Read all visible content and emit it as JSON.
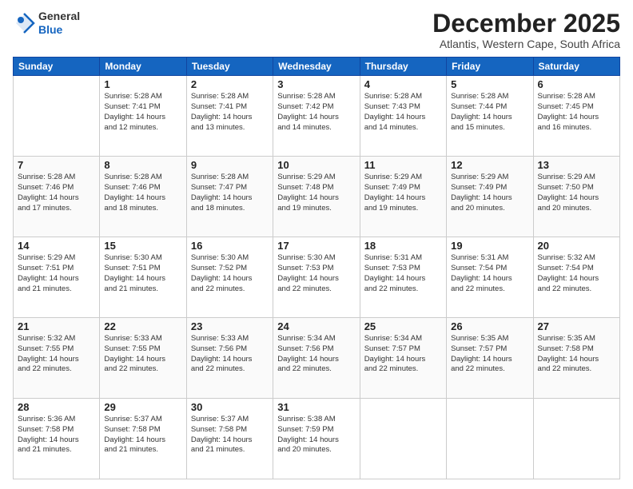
{
  "logo": {
    "general": "General",
    "blue": "Blue"
  },
  "title": "December 2025",
  "subtitle": "Atlantis, Western Cape, South Africa",
  "days": [
    "Sunday",
    "Monday",
    "Tuesday",
    "Wednesday",
    "Thursday",
    "Friday",
    "Saturday"
  ],
  "weeks": [
    [
      {
        "num": "",
        "info": ""
      },
      {
        "num": "1",
        "info": "Sunrise: 5:28 AM\nSunset: 7:41 PM\nDaylight: 14 hours\nand 12 minutes."
      },
      {
        "num": "2",
        "info": "Sunrise: 5:28 AM\nSunset: 7:41 PM\nDaylight: 14 hours\nand 13 minutes."
      },
      {
        "num": "3",
        "info": "Sunrise: 5:28 AM\nSunset: 7:42 PM\nDaylight: 14 hours\nand 14 minutes."
      },
      {
        "num": "4",
        "info": "Sunrise: 5:28 AM\nSunset: 7:43 PM\nDaylight: 14 hours\nand 14 minutes."
      },
      {
        "num": "5",
        "info": "Sunrise: 5:28 AM\nSunset: 7:44 PM\nDaylight: 14 hours\nand 15 minutes."
      },
      {
        "num": "6",
        "info": "Sunrise: 5:28 AM\nSunset: 7:45 PM\nDaylight: 14 hours\nand 16 minutes."
      }
    ],
    [
      {
        "num": "7",
        "info": "Sunrise: 5:28 AM\nSunset: 7:46 PM\nDaylight: 14 hours\nand 17 minutes."
      },
      {
        "num": "8",
        "info": "Sunrise: 5:28 AM\nSunset: 7:46 PM\nDaylight: 14 hours\nand 18 minutes."
      },
      {
        "num": "9",
        "info": "Sunrise: 5:28 AM\nSunset: 7:47 PM\nDaylight: 14 hours\nand 18 minutes."
      },
      {
        "num": "10",
        "info": "Sunrise: 5:29 AM\nSunset: 7:48 PM\nDaylight: 14 hours\nand 19 minutes."
      },
      {
        "num": "11",
        "info": "Sunrise: 5:29 AM\nSunset: 7:49 PM\nDaylight: 14 hours\nand 19 minutes."
      },
      {
        "num": "12",
        "info": "Sunrise: 5:29 AM\nSunset: 7:49 PM\nDaylight: 14 hours\nand 20 minutes."
      },
      {
        "num": "13",
        "info": "Sunrise: 5:29 AM\nSunset: 7:50 PM\nDaylight: 14 hours\nand 20 minutes."
      }
    ],
    [
      {
        "num": "14",
        "info": "Sunrise: 5:29 AM\nSunset: 7:51 PM\nDaylight: 14 hours\nand 21 minutes."
      },
      {
        "num": "15",
        "info": "Sunrise: 5:30 AM\nSunset: 7:51 PM\nDaylight: 14 hours\nand 21 minutes."
      },
      {
        "num": "16",
        "info": "Sunrise: 5:30 AM\nSunset: 7:52 PM\nDaylight: 14 hours\nand 22 minutes."
      },
      {
        "num": "17",
        "info": "Sunrise: 5:30 AM\nSunset: 7:53 PM\nDaylight: 14 hours\nand 22 minutes."
      },
      {
        "num": "18",
        "info": "Sunrise: 5:31 AM\nSunset: 7:53 PM\nDaylight: 14 hours\nand 22 minutes."
      },
      {
        "num": "19",
        "info": "Sunrise: 5:31 AM\nSunset: 7:54 PM\nDaylight: 14 hours\nand 22 minutes."
      },
      {
        "num": "20",
        "info": "Sunrise: 5:32 AM\nSunset: 7:54 PM\nDaylight: 14 hours\nand 22 minutes."
      }
    ],
    [
      {
        "num": "21",
        "info": "Sunrise: 5:32 AM\nSunset: 7:55 PM\nDaylight: 14 hours\nand 22 minutes."
      },
      {
        "num": "22",
        "info": "Sunrise: 5:33 AM\nSunset: 7:55 PM\nDaylight: 14 hours\nand 22 minutes."
      },
      {
        "num": "23",
        "info": "Sunrise: 5:33 AM\nSunset: 7:56 PM\nDaylight: 14 hours\nand 22 minutes."
      },
      {
        "num": "24",
        "info": "Sunrise: 5:34 AM\nSunset: 7:56 PM\nDaylight: 14 hours\nand 22 minutes."
      },
      {
        "num": "25",
        "info": "Sunrise: 5:34 AM\nSunset: 7:57 PM\nDaylight: 14 hours\nand 22 minutes."
      },
      {
        "num": "26",
        "info": "Sunrise: 5:35 AM\nSunset: 7:57 PM\nDaylight: 14 hours\nand 22 minutes."
      },
      {
        "num": "27",
        "info": "Sunrise: 5:35 AM\nSunset: 7:58 PM\nDaylight: 14 hours\nand 22 minutes."
      }
    ],
    [
      {
        "num": "28",
        "info": "Sunrise: 5:36 AM\nSunset: 7:58 PM\nDaylight: 14 hours\nand 21 minutes."
      },
      {
        "num": "29",
        "info": "Sunrise: 5:37 AM\nSunset: 7:58 PM\nDaylight: 14 hours\nand 21 minutes."
      },
      {
        "num": "30",
        "info": "Sunrise: 5:37 AM\nSunset: 7:58 PM\nDaylight: 14 hours\nand 21 minutes."
      },
      {
        "num": "31",
        "info": "Sunrise: 5:38 AM\nSunset: 7:59 PM\nDaylight: 14 hours\nand 20 minutes."
      },
      {
        "num": "",
        "info": ""
      },
      {
        "num": "",
        "info": ""
      },
      {
        "num": "",
        "info": ""
      }
    ]
  ]
}
